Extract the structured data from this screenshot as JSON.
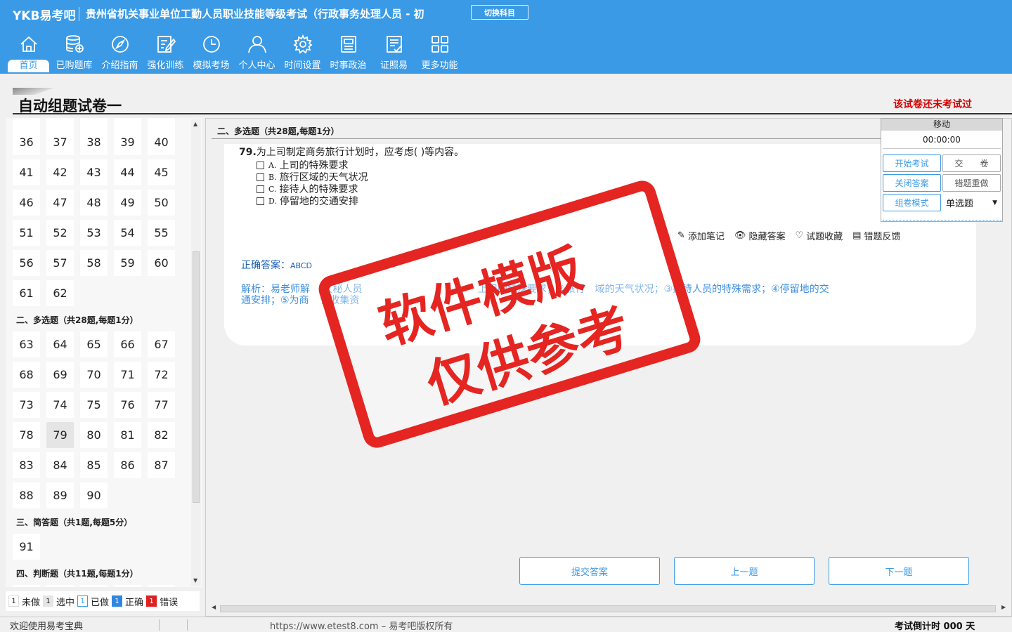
{
  "header": {
    "logo": "YKB易考吧",
    "title": "贵州省机关事业单位工勤人员职业技能等级考试（行政事务处理人员 - 初",
    "switch_label": "切换科目",
    "nav": [
      {
        "label": "首页",
        "icon": "home-icon"
      },
      {
        "label": "已购题库",
        "icon": "database-icon"
      },
      {
        "label": "介绍指南",
        "icon": "compass-icon"
      },
      {
        "label": "强化训练",
        "icon": "edit-icon"
      },
      {
        "label": "模拟考场",
        "icon": "clock-icon"
      },
      {
        "label": "个人中心",
        "icon": "user-icon"
      },
      {
        "label": "时间设置",
        "icon": "gear-icon"
      },
      {
        "label": "时事政治",
        "icon": "newspaper-icon"
      },
      {
        "label": "证照易",
        "icon": "certificate-icon"
      },
      {
        "label": "更多功能",
        "icon": "grid-icon"
      }
    ]
  },
  "paper": {
    "title": "自动组题试卷一",
    "status": "该试卷还未考试过"
  },
  "left": {
    "sections": [
      {
        "title": "二、多选题（共28题,每题1分）"
      },
      {
        "title": "三、简答题（共1题,每题5分）"
      },
      {
        "title": "四、判断题（共11题,每题1分）"
      }
    ],
    "current_question": 79,
    "legend": {
      "undone_count": "1",
      "undone_label": "未做",
      "selected_count": "1",
      "selected_label": "选中",
      "done_count": "1",
      "done_label": "已做",
      "correct_count": "1",
      "correct_label": "正确",
      "wrong_count": "1",
      "wrong_label": "错误"
    }
  },
  "main": {
    "section_title": "二、多选题（共28题,每题1分）",
    "question": {
      "number": "79.",
      "text": "为上司制定商务旅行计划时，应考虑(  )等内容。",
      "options": [
        {
          "letter": "A.",
          "text": "上司的特殊要求"
        },
        {
          "letter": "B.",
          "text": "旅行区域的天气状况"
        },
        {
          "letter": "C.",
          "text": "接待人的特殊要求"
        },
        {
          "letter": "D.",
          "text": "停留地的交通安排"
        }
      ]
    },
    "tools": {
      "note": "添加笔记",
      "hide_answer": "隐藏答案",
      "favorite": "试题收藏",
      "feedback": "错题反馈"
    },
    "answer_label": "正确答案：",
    "answer_value": "ABCD",
    "analysis_parts": [
      "解析：易老师解",
      "文秘人员",
      "上司的特殊要求；②旅行",
      "域的天气状况；③接待人员的特殊需求；④停留地的交",
      "通安排；⑤为商",
      "谈收集资"
    ],
    "buttons": {
      "submit": "提交答案",
      "prev": "上一题",
      "next": "下一题"
    }
  },
  "tool_panel": {
    "head": "移动",
    "timer": "00:00:00",
    "start_exam": "开始考试",
    "hand_in": "交　　卷",
    "close_answer": "关闭答案",
    "redo_wrong": "错题重做",
    "compose_mode": "组卷模式",
    "mode_value": "单选题"
  },
  "watermark": {
    "line1": "软件模版",
    "line2": "仅供参考"
  },
  "statusbar": {
    "welcome": "欢迎使用易考宝典",
    "copyright": "https://www.etest8.com – 易考吧版权所有",
    "countdown": "考试倒计时 000 天"
  },
  "colors": {
    "header_blue": "#3b9ae6",
    "stamp_red": "#e52521",
    "status_red": "#d40000"
  }
}
